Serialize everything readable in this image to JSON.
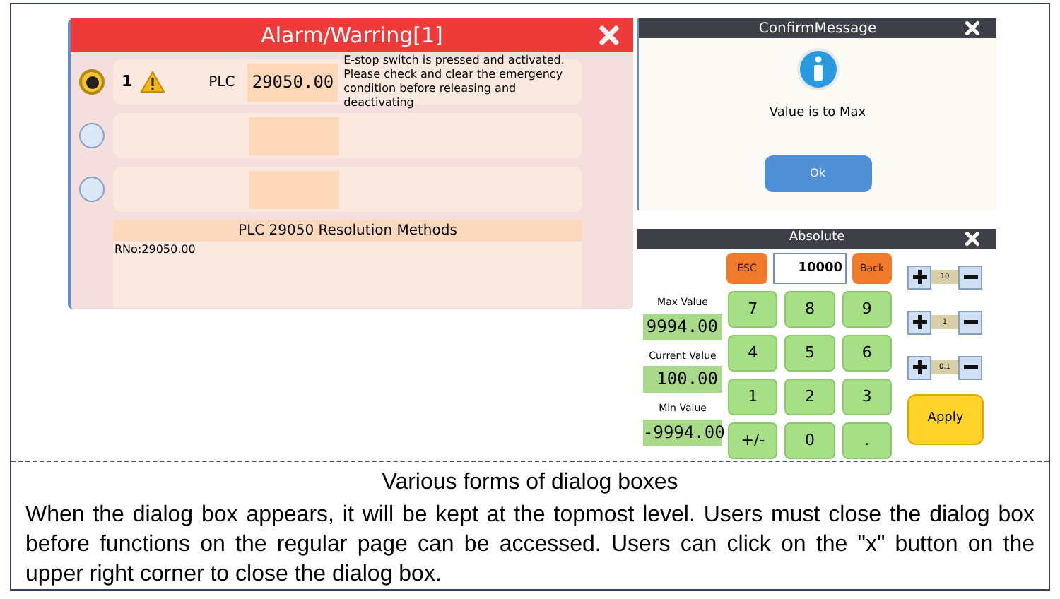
{
  "alarm_dialog": {
    "title": "Alarm/Warring[1]",
    "rows": [
      {
        "selected": true,
        "number": "1",
        "warning": true,
        "source": "PLC",
        "code": "29050.00",
        "message": "E-stop switch is pressed and activated. Please check and clear the emergency condition before releasing and deactivating"
      },
      {
        "selected": false
      },
      {
        "selected": false
      }
    ],
    "resolution": {
      "title": "PLC 29050 Resolution Methods",
      "text": "RNo:29050.00"
    }
  },
  "confirm_dialog": {
    "title": "ConfirmMessage",
    "message": "Value is to Max",
    "button": "Ok"
  },
  "keypad_dialog": {
    "title": "Absolute",
    "esc": "ESC",
    "value": "10000",
    "back": "Back",
    "readouts": [
      {
        "label": "Max Value",
        "value": "9994.00"
      },
      {
        "label": "Current Value",
        "value": "100.00"
      },
      {
        "label": "Min Value",
        "value": "-9994.00"
      }
    ],
    "keys": [
      "7",
      "8",
      "9",
      "4",
      "5",
      "6",
      "1",
      "2",
      "3",
      "+/-",
      "0",
      "."
    ],
    "steps": [
      "10",
      "1",
      "0.1"
    ],
    "apply": "Apply"
  },
  "caption": {
    "title": "Various forms of dialog boxes",
    "text": "When the dialog box appears, it will be kept at the topmost level. Users must close the dialog box before functions on the regular page can be accessed. Users can click on the \"x\" button on the upper right corner to close the dialog box."
  }
}
